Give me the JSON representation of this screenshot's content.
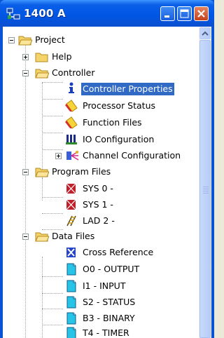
{
  "window": {
    "title": "1400 A",
    "colors": {
      "titlebar": "#0057e5",
      "selection": "#316ac5",
      "folder": "#f5d36b"
    }
  },
  "tree": {
    "root": "Project",
    "help": "Help",
    "controller": "Controller",
    "controller_properties": "Controller Properties",
    "processor_status": "Processor Status",
    "function_files": "Function Files",
    "io_configuration": "IO Configuration",
    "channel_configuration": "Channel Configuration",
    "program_files": "Program Files",
    "sys0": "SYS 0 -",
    "sys1": "SYS 1 -",
    "lad2": "LAD 2 -",
    "data_files": "Data Files",
    "cross_reference": "Cross Reference",
    "o0": "O0 - OUTPUT",
    "i1": "I1 - INPUT",
    "s2": "S2 - STATUS",
    "b3": "B3 - BINARY",
    "t4": "T4 - TIMER"
  }
}
